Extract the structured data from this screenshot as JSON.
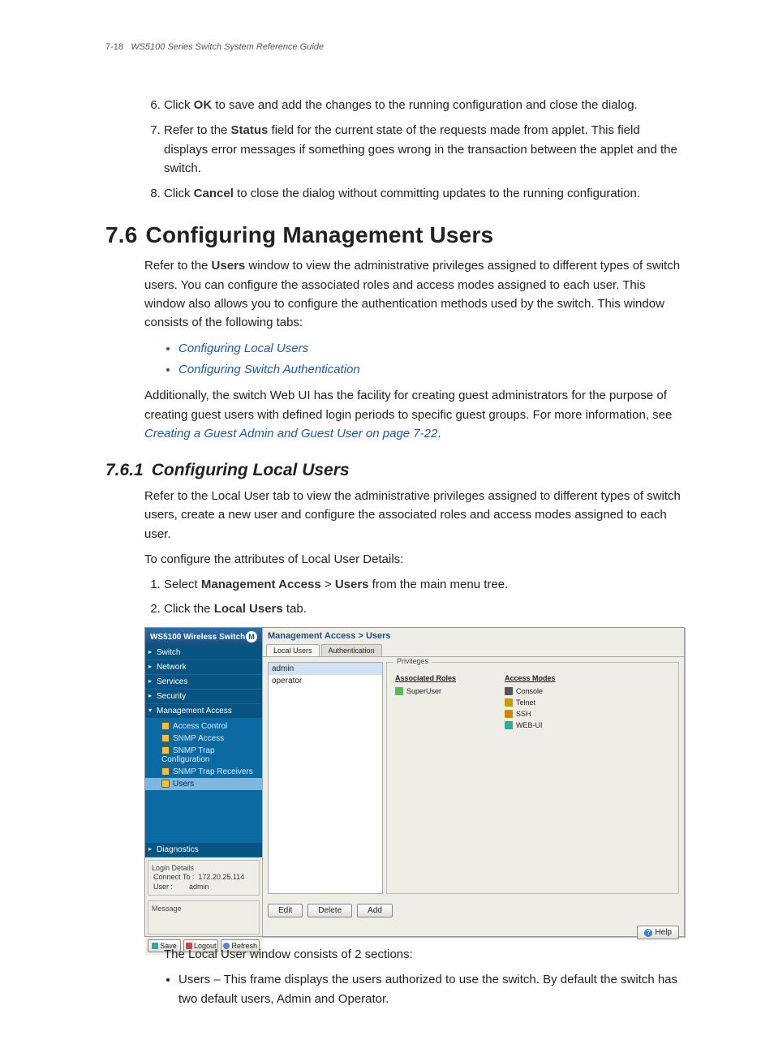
{
  "header": {
    "page": "7-18",
    "title": "WS5100 Series Switch System Reference Guide"
  },
  "steps_a": {
    "s6a": "Click ",
    "s6b": "OK",
    "s6c": " to save and add the changes to the running configuration and close the dialog.",
    "s7a": "Refer to the ",
    "s7b": "Status",
    "s7c": " field for the current state of the requests made from applet. This field displays error messages if something goes wrong in the transaction between the applet and the switch.",
    "s8a": "Click ",
    "s8b": "Cancel",
    "s8c": " to close the dialog without committing updates to the running configuration."
  },
  "section": {
    "num": "7.6",
    "title": "Configuring Management Users"
  },
  "para1a": "Refer to the ",
  "para1b": "Users",
  "para1c": " window to view the administrative privileges assigned to different types of switch users. You can configure the associated roles and access modes assigned to each user. This window also allows you to configure the authentication methods used by the switch. This window consists of the following tabs:",
  "bullets": {
    "b1": "Configuring Local Users",
    "b2": "Configuring Switch Authentication"
  },
  "para2a": "Additionally, the switch Web UI has the facility for creating guest administrators for the purpose of creating guest users with defined login periods to specific guest groups. For more information, see ",
  "para2b": "Creating a Guest Admin and Guest User on page 7-22",
  "para2c": ".",
  "subsection": {
    "num": "7.6.1",
    "title": "Configuring Local Users"
  },
  "para3": "Refer to the Local User tab to view the administrative privileges assigned to different types of switch users, create a new user and configure the associated roles and access modes assigned to each user.",
  "para4": "To configure the attributes of Local User Details:",
  "steps_b": {
    "s1a": "Select ",
    "s1b": "Management Access",
    "s1c": " > ",
    "s1d": "Users",
    "s1e": " from the main menu tree.",
    "s2a": "Click the ",
    "s2b": "Local Users",
    "s2c": " tab."
  },
  "shot": {
    "title": "WS5100 Wireless Switch",
    "nav": {
      "switch": "Switch",
      "network": "Network",
      "services": "Services",
      "security": "Security",
      "mgmt": "Management Access",
      "sub": {
        "ac": "Access Control",
        "snmpa": "SNMP Access",
        "snmptc": "SNMP Trap Configuration",
        "snmptr": "SNMP Trap Receivers",
        "users": "Users"
      },
      "diag": "Diagnostics"
    },
    "login": {
      "legend": "Login Details",
      "row1a": "Connect To :",
      "row1b": "172.20.25.114",
      "row2a": "User :",
      "row2b": "admin"
    },
    "msg_legend": "Message",
    "btns": {
      "save": "Save",
      "logout": "Logout",
      "refresh": "Refresh"
    },
    "crumb": "Management Access > Users",
    "tabs": {
      "t1": "Local Users",
      "t2": "Authentication"
    },
    "users": {
      "u1": "admin",
      "u2": "operator"
    },
    "priv": {
      "legend": "Privileges",
      "roles_title": "Associated Roles",
      "role1": "SuperUser",
      "modes_title": "Access Modes",
      "m1": "Console",
      "m2": "Telnet",
      "m3": "SSH",
      "m4": "WEB-UI"
    },
    "actions": {
      "edit": "Edit",
      "delete": "Delete",
      "add": "Add"
    },
    "help": "Help"
  },
  "para5": "The Local User window consists of 2 sections:",
  "tail_bullet": "Users – This frame displays the users authorized to use the switch. By default the switch has two default users, Admin and Operator."
}
